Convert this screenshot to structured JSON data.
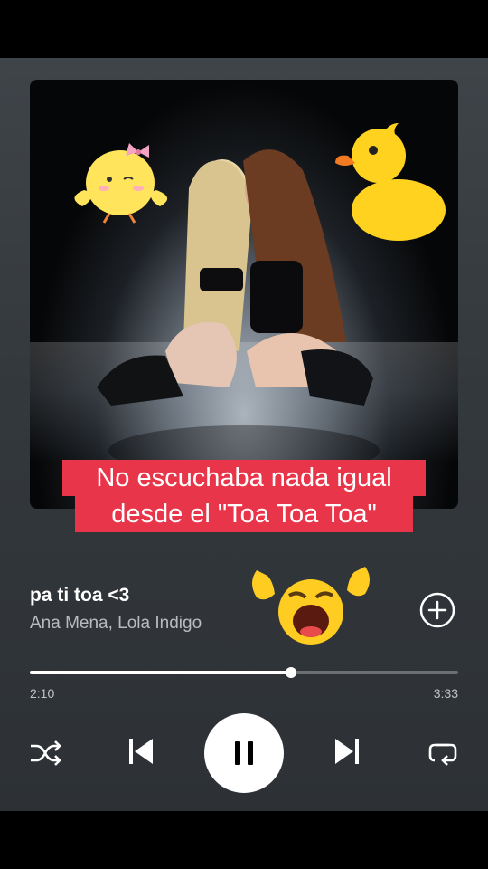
{
  "overlay": {
    "caption_line1": "No escuchaba nada igual",
    "caption_line2": "desde el \"Toa Toa Toa\""
  },
  "track": {
    "title": "pa ti toa <3",
    "artists": "Ana Mena, Lola Indigo"
  },
  "progress": {
    "current": "2:10",
    "duration": "3:33",
    "fraction": 0.61
  },
  "controls": [
    "shuffle-icon",
    "previous-icon",
    "pause-icon",
    "next-icon",
    "repeat-icon",
    "add-icon"
  ],
  "colors": {
    "accent_caption": "#e9354a",
    "background": "#363b3f"
  }
}
